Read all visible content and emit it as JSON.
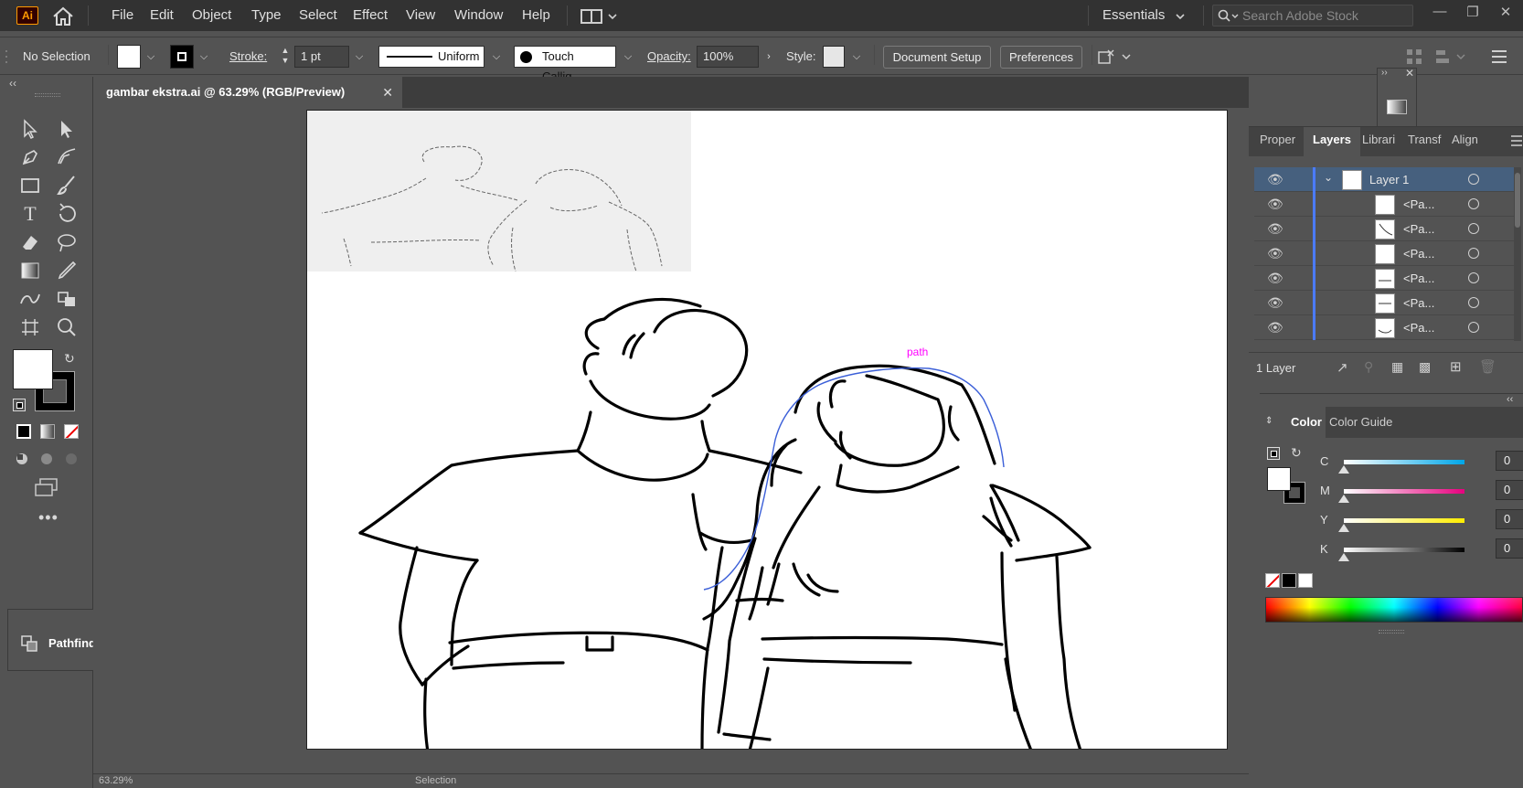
{
  "app": {
    "logo": "Ai"
  },
  "menu": {
    "items": [
      "File",
      "Edit",
      "Object",
      "Type",
      "Select",
      "Effect",
      "View",
      "Window",
      "Help"
    ],
    "workspace": "Essentials",
    "search_placeholder": "Search Adobe Stock"
  },
  "control": {
    "selection": "No Selection",
    "stroke_label": "Stroke:",
    "stroke_value": "1 pt",
    "profile": "Uniform",
    "brush": "Touch Callig...",
    "opacity_label": "Opacity:",
    "opacity_value": "100%",
    "style_label": "Style:",
    "document_setup": "Document Setup",
    "preferences": "Preferences"
  },
  "document": {
    "tab_title": "gambar ekstra.ai @ 63.29% (RGB/Preview)",
    "hover_label": "path"
  },
  "layers": {
    "tabs": [
      "Proper",
      "Layers",
      "Librari",
      "Transf",
      "Align"
    ],
    "active_tab": "Layers",
    "rows": [
      {
        "name": "Layer 1",
        "kind": "layer"
      },
      {
        "name": "<Pa...",
        "kind": "path"
      },
      {
        "name": "<Pa...",
        "kind": "path"
      },
      {
        "name": "<Pa...",
        "kind": "path"
      },
      {
        "name": "<Pa...",
        "kind": "path"
      },
      {
        "name": "<Pa...",
        "kind": "path"
      },
      {
        "name": "<Pa...",
        "kind": "path"
      }
    ],
    "footer": "1 Layer"
  },
  "color": {
    "tabs": [
      "Color",
      "Color Guide"
    ],
    "channels": [
      {
        "label": "C",
        "value": "0"
      },
      {
        "label": "M",
        "value": "0"
      },
      {
        "label": "Y",
        "value": "0"
      },
      {
        "label": "K",
        "value": "0"
      }
    ]
  },
  "pathfinder": {
    "label": "Pathfinder"
  },
  "status": {
    "zoom": "63.29%",
    "mode": "Selection"
  },
  "colors": {
    "accent": "#4b7bff",
    "ai_orange": "#ff9a00",
    "path_label": "#ff00ff"
  }
}
